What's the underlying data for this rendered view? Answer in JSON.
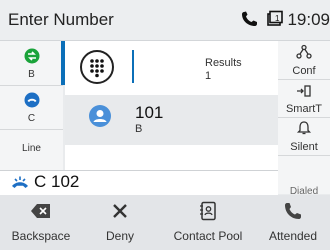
{
  "title": "Enter Number",
  "status": {
    "time": "19:09"
  },
  "left_lines": [
    {
      "label": "B"
    },
    {
      "label": "C"
    },
    {
      "label": "Line"
    }
  ],
  "results": {
    "label": "Results",
    "count": "1"
  },
  "contact": {
    "number": "101",
    "line": "B"
  },
  "right_softkeys": [
    {
      "label": "Conf"
    },
    {
      "label": "SmartT"
    },
    {
      "label": "Silent"
    },
    {
      "label": "Dialed"
    }
  ],
  "active_call": {
    "text": "C 102"
  },
  "bottom_softkeys": [
    {
      "label": "Backspace"
    },
    {
      "label": "Deny"
    },
    {
      "label": "Contact Pool"
    },
    {
      "label": "Attended"
    }
  ],
  "colors": {
    "accent": "#0b6fb8",
    "green": "#1aa33a",
    "call_blue": "#1d6fc4"
  }
}
